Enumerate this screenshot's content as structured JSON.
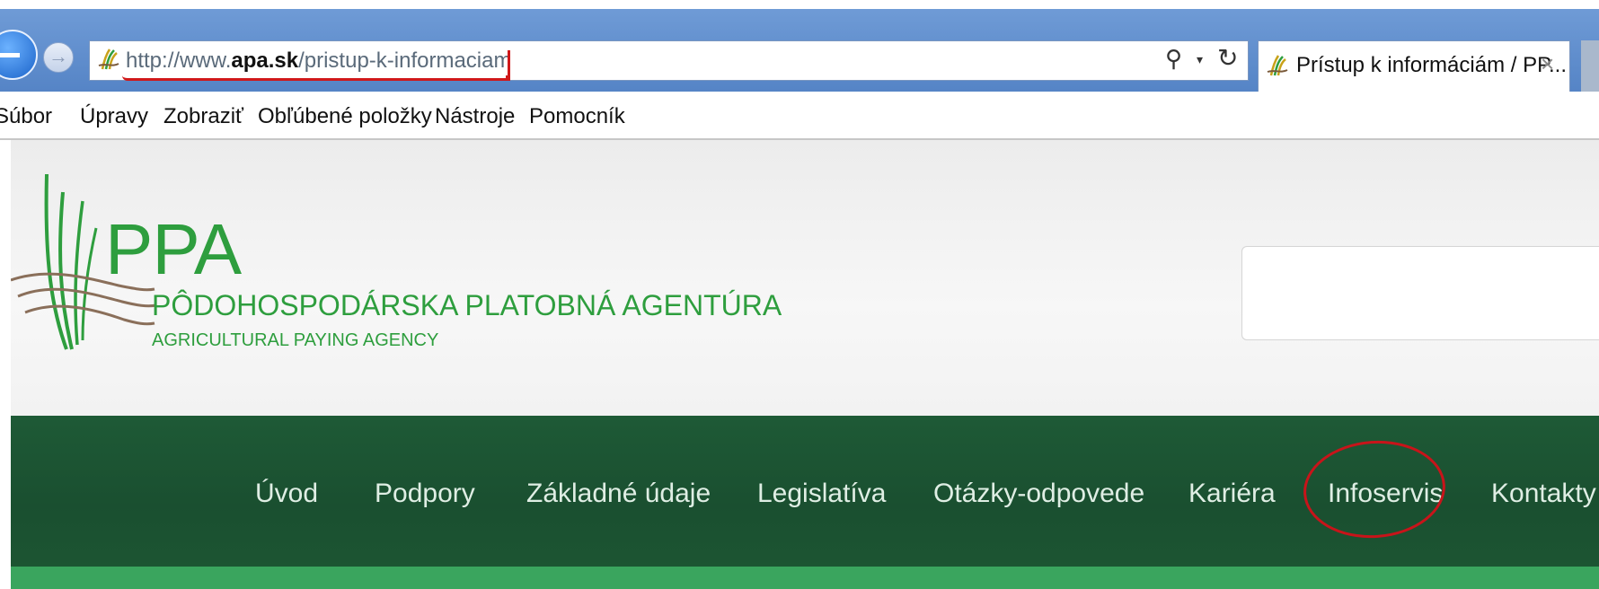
{
  "browser": {
    "url_prefix": "http://www.",
    "url_domain": "apa.sk",
    "url_path": "/pristup-k-informaciam",
    "tab_title": "Prístup k informáciám / PP...",
    "tab_close": "×",
    "search_glyph": "⚲",
    "dropdown_glyph": "▾",
    "refresh_glyph": "↻",
    "forward_glyph": "→",
    "accent_color": "#d0181a"
  },
  "menu": {
    "items": [
      "Súbor",
      "Úpravy",
      "Zobraziť",
      "Obľúbené položky",
      "Nástroje",
      "Pomocník"
    ]
  },
  "header": {
    "logo_text": "PPA",
    "org_name": "PÔDOHOSPODÁRSKA PLATOBNÁ AGENTÚRA",
    "org_name_en": "AGRICULTURAL PAYING AGENCY",
    "brand_color": "#2e9e3e"
  },
  "nav": {
    "items": [
      "Úvod",
      "Podpory",
      "Základné údaje",
      "Legislatíva",
      "Otázky-odpovede",
      "Kariéra",
      "Infoservis",
      "Kontakty"
    ],
    "highlighted": "Infoservis",
    "background_color": "#1c5532"
  }
}
